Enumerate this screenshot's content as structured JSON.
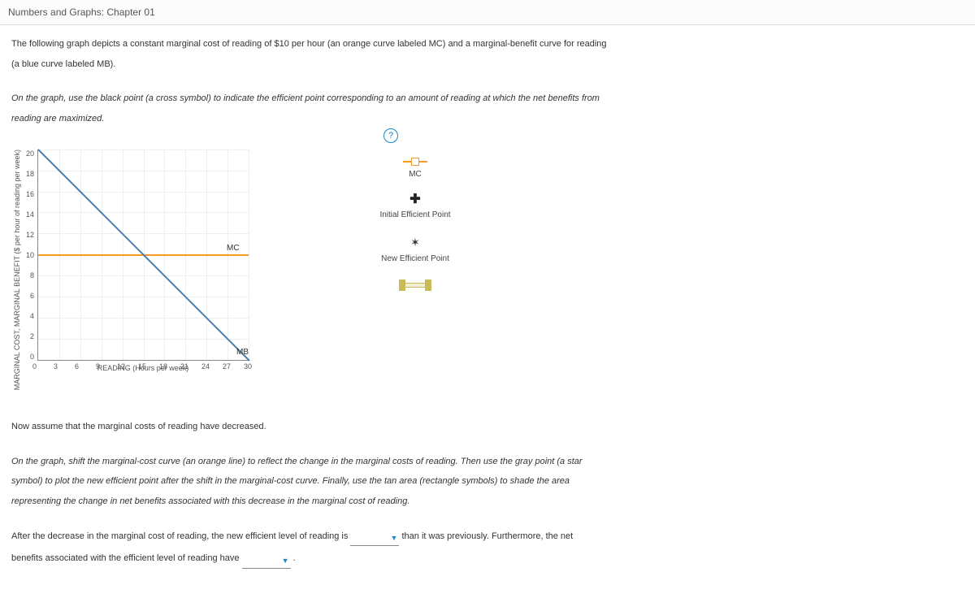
{
  "header": {
    "title": "Numbers and Graphs: Chapter 01"
  },
  "intro": {
    "p1": "The following graph depicts a constant marginal cost of reading of $10 per hour (an orange curve labeled MC) and a marginal-benefit curve for reading",
    "p2": "(a blue curve labeled MB)."
  },
  "instruction1": {
    "p1": "On the graph, use the black point (a cross symbol) to indicate the efficient point corresponding to an amount of reading at which the net benefits from",
    "p2": "reading are maximized."
  },
  "help_tooltip": "?",
  "chart_data": {
    "type": "line",
    "xlabel": "READING (Hours per week)",
    "ylabel": "MARGINAL COST, MARGINAL BENEFIT ($ per hour of reading per week)",
    "x_ticks": [
      "0",
      "3",
      "6",
      "9",
      "12",
      "15",
      "18",
      "21",
      "24",
      "27",
      "30"
    ],
    "y_ticks": [
      "20",
      "18",
      "16",
      "14",
      "12",
      "10",
      "8",
      "6",
      "4",
      "2",
      "0"
    ],
    "xlim": [
      0,
      30
    ],
    "ylim": [
      0,
      20
    ],
    "series": [
      {
        "name": "MC",
        "color": "#f59a22",
        "type": "horizontal",
        "y": 10
      },
      {
        "name": "MB",
        "color": "#4a7fb5",
        "type": "line",
        "points": [
          [
            0,
            20
          ],
          [
            30,
            0
          ]
        ]
      }
    ],
    "curve_labels": {
      "mc": "MC",
      "mb": "MB"
    }
  },
  "legend": {
    "mc": "MC",
    "initial": "Initial Efficient Point",
    "new": "New Efficient Point"
  },
  "mid_text": {
    "p1": "Now assume that the marginal costs of reading have decreased."
  },
  "instruction2": {
    "p1": "On the graph, shift the marginal-cost curve (an orange line) to reflect the change in the marginal costs of reading. Then use the gray point (a star",
    "p2": "symbol) to plot the new efficient point after the shift in the marginal-cost curve. Finally, use the tan area (rectangle symbols) to shade the area",
    "p3": "representing the change in net benefits associated with this decrease in the marginal cost of reading."
  },
  "fill": {
    "prefix": "After the decrease in the marginal cost of reading, the new efficient level of reading is",
    "mid": "than it was previously. Furthermore, the net",
    "line2_prefix": "benefits associated with the efficient level of reading have",
    "dot": ".",
    "dropdown_placeholder": ""
  }
}
